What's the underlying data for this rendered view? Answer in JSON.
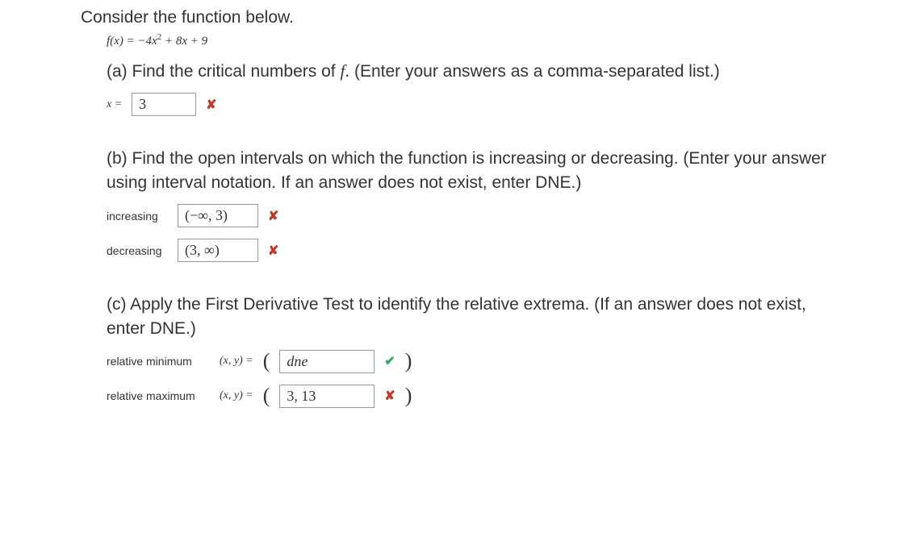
{
  "intro": "Consider the function below.",
  "function_def_html": "f(x) = −4x<span class='sup'>2</span> + 8x + 9",
  "partA": {
    "text_html": "(a) Find the critical numbers of <span class='fvar'>f</span>. (Enter your answers as a comma-separated list.)",
    "label": "x =",
    "value": "3",
    "status": "wrong"
  },
  "partB": {
    "text": "(b) Find the open intervals on which the function is increasing or decreasing. (Enter your answer using interval notation. If an answer does not exist, enter DNE.)",
    "rows": [
      {
        "label": "increasing",
        "value": "(−∞, 3)",
        "status": "wrong"
      },
      {
        "label": "decreasing",
        "value": "(3, ∞)",
        "status": "wrong"
      }
    ]
  },
  "partC": {
    "text": "(c) Apply the First Derivative Test to identify the relative extrema. (If an answer does not exist, enter DNE.)",
    "xy_label": "(x, y) =",
    "rows": [
      {
        "label": "relative minimum",
        "value": "dne",
        "italic": true,
        "status": "correct"
      },
      {
        "label": "relative maximum",
        "value": "3, 13",
        "italic": false,
        "status": "wrong"
      }
    ]
  },
  "icons": {
    "wrong": "✘",
    "correct": "✔"
  }
}
